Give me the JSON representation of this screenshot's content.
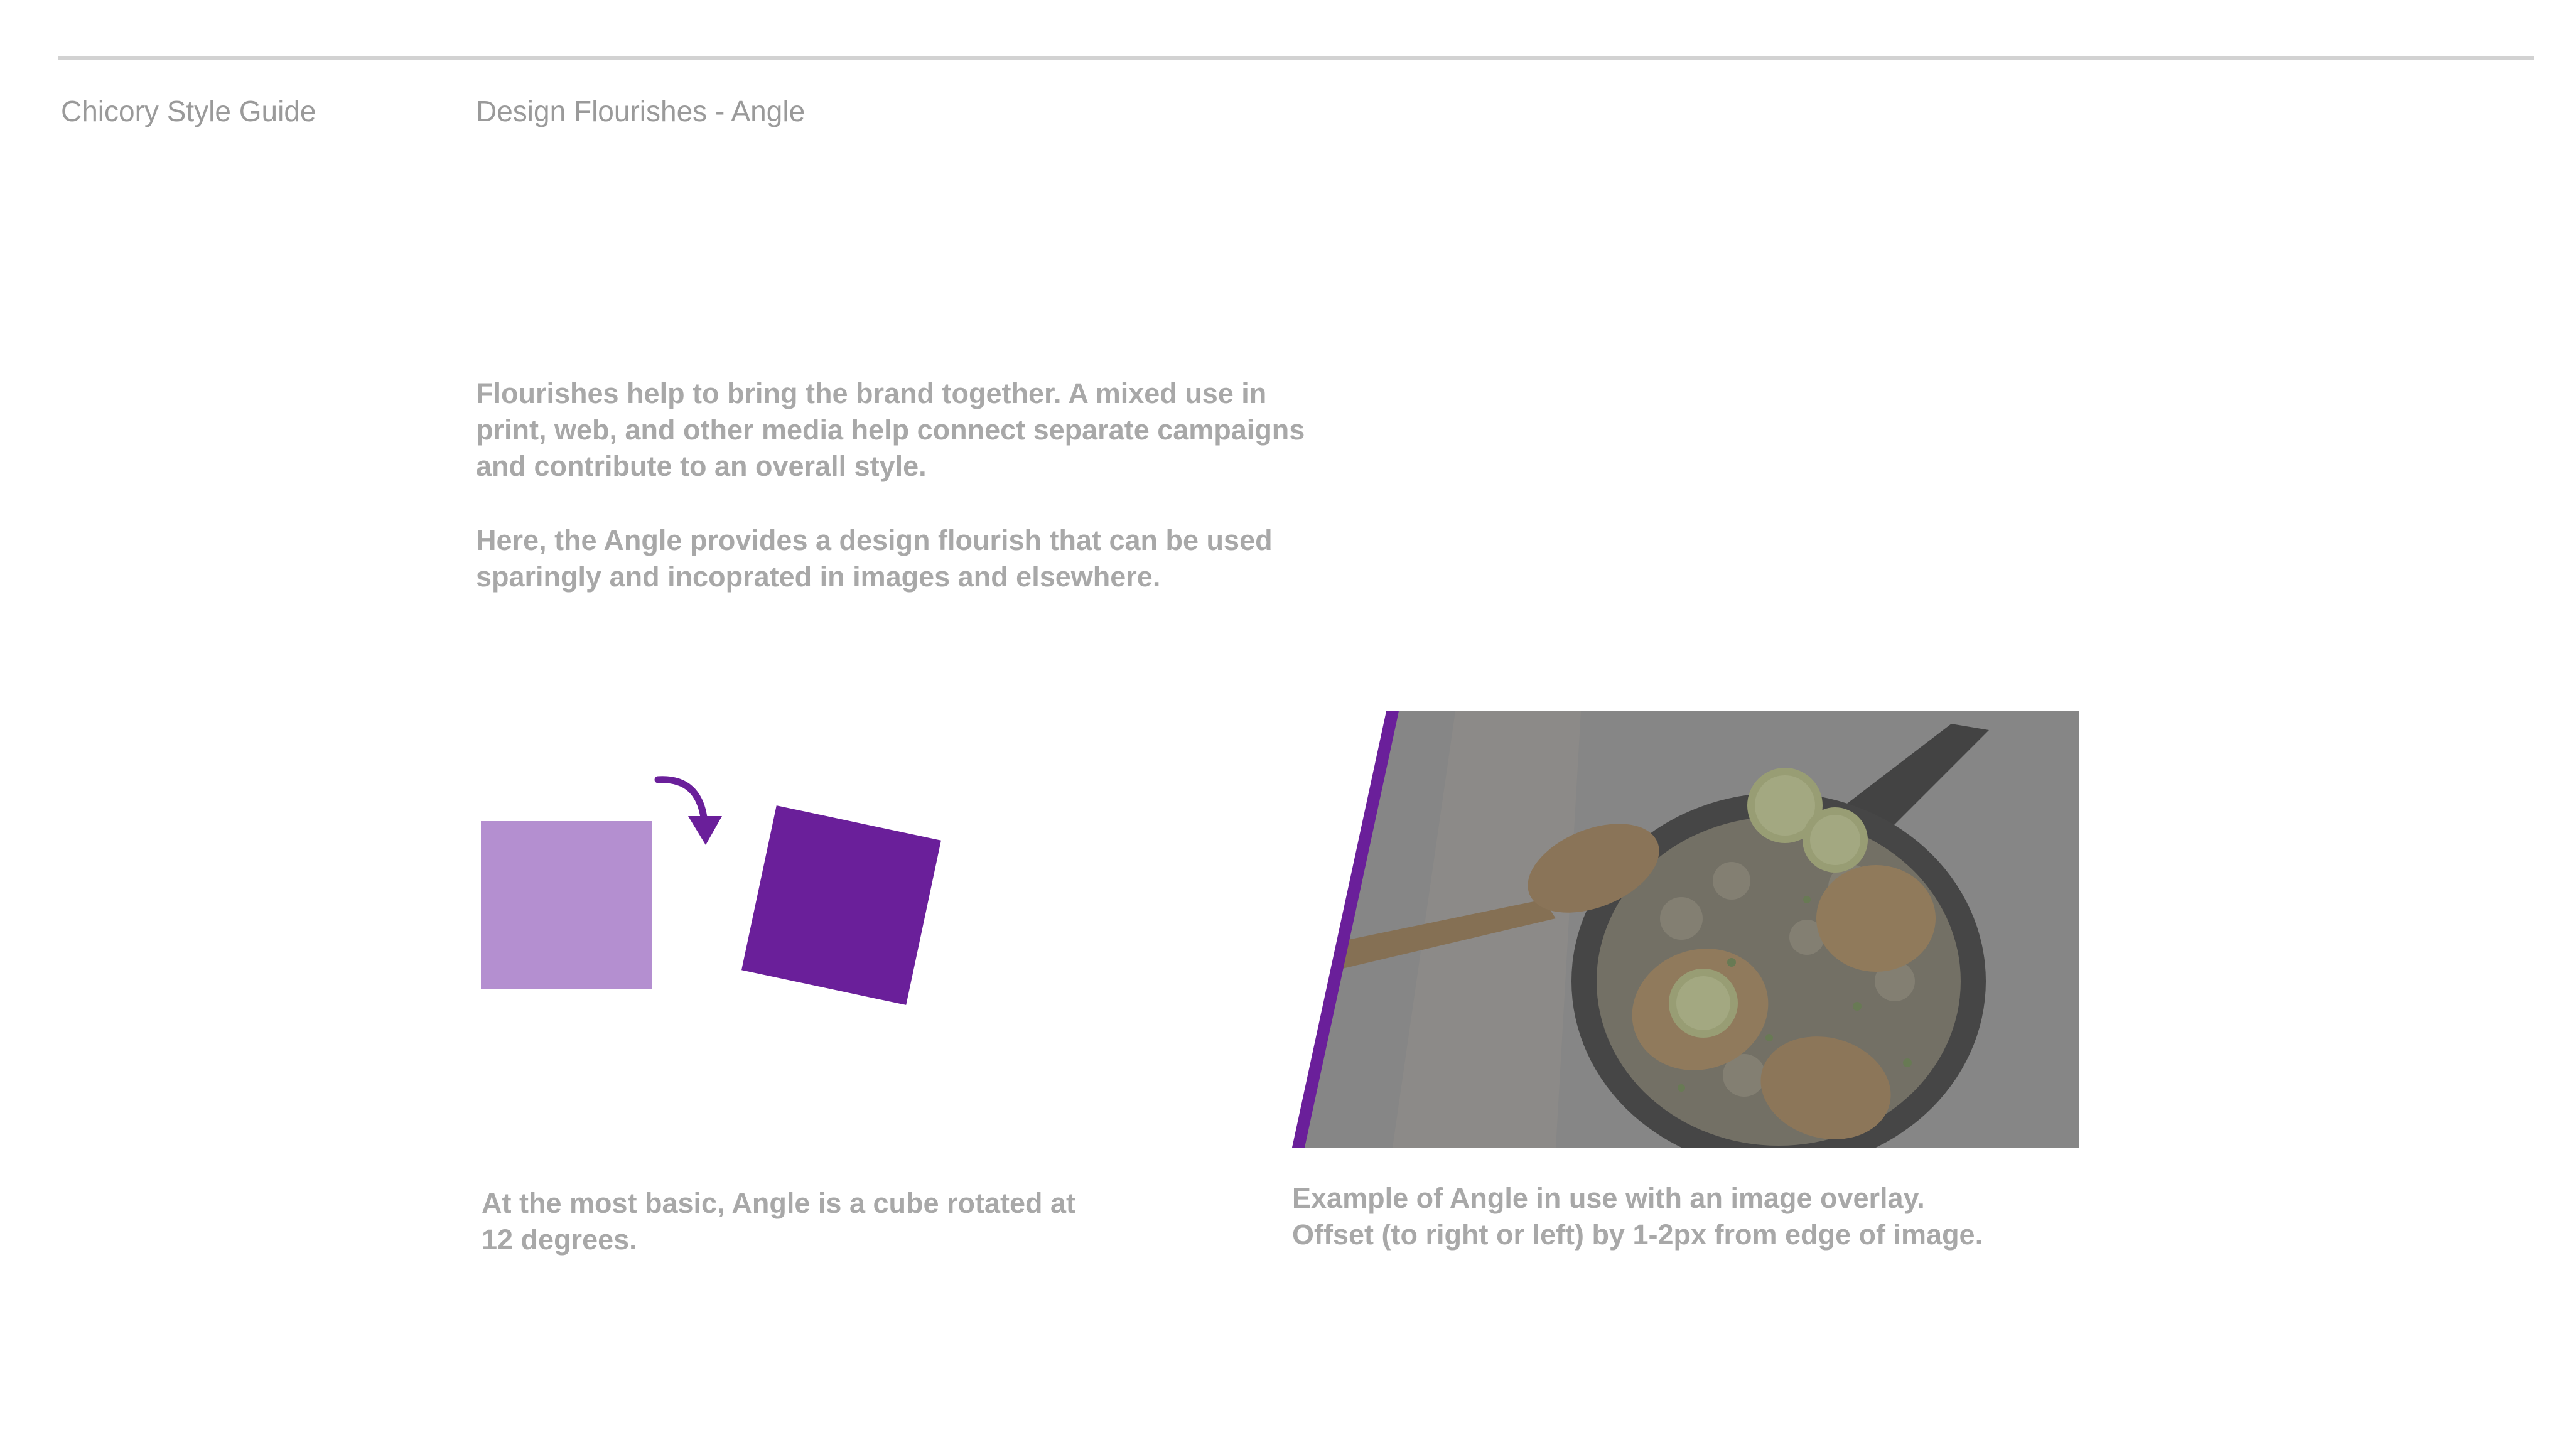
{
  "header": {
    "guide_title": "Chicory Style Guide",
    "section_title": "Design Flourishes - Angle"
  },
  "intro": {
    "paragraph_1": "Flourishes help to bring the brand together. A mixed use in print, web, and other media help connect separate campaigns and contribute to an overall style.",
    "paragraph_2": "Here, the Angle provides a design flourish that can be used sparingly and incoprated in images and elsewhere."
  },
  "angle_demo": {
    "rotation_degrees": 12,
    "caption": "At the most basic, Angle is a cube rotated at 12 degrees.",
    "original_square_color": "#b48fd0",
    "rotated_square_color": "#6a1f9a",
    "arrow_icon": "rotate-clockwise-arrow"
  },
  "example": {
    "caption_line_1": "Example of Angle in use with an image overlay.",
    "caption_line_2": "Offset (to right or left) by 1-2px from edge of image.",
    "accent_color": "#6a1f9a",
    "overlay_color": "#7a7a7a"
  },
  "colors": {
    "rule": "#d2d2d2",
    "header_text": "#9a9a9a",
    "body_text": "#a8a8a8"
  }
}
